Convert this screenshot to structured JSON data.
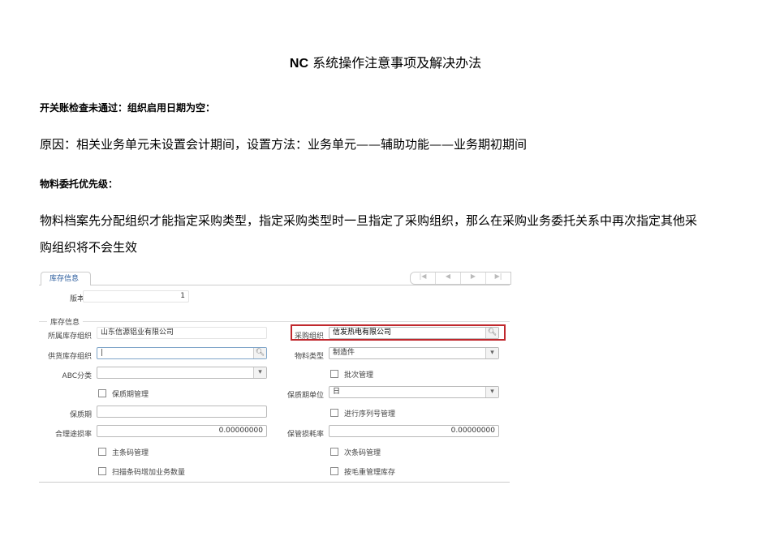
{
  "title": {
    "prefix": "NC",
    "rest": " 系统操作注意事项及解决办法"
  },
  "section1": {
    "heading": "开关账检查未通过：组织启用日期为空：",
    "body": "原因：相关业务单元未设置会计期间，设置方法：业务单元——辅助功能——业务期初期间"
  },
  "section2": {
    "heading": "物料委托优先级：",
    "body_line1": "物料档案先分配组织才能指定采购类型，指定采购类型时一旦指定了采购组织，那么在采购业务委托关系中再次指定其他采",
    "body_line2": "购组织将不会生效"
  },
  "screenshot": {
    "tab": "库存信息",
    "nav": [
      "first",
      "prev",
      "next",
      "last"
    ],
    "version_label": "版本号",
    "version_value": "1",
    "group_label": "库存信息",
    "owner_org_label": "所属库存组织",
    "owner_org_value": "山东信源铝业有限公司",
    "purchase_org_label": "采购组织",
    "purchase_org_value": "信发热电有限公司",
    "supply_org_label": "供货库存组织",
    "supply_org_value": "",
    "material_type_label": "物料类型",
    "material_type_value": "制造件",
    "abc_label": "ABC分类",
    "abc_value": "",
    "batch_label": "批次管理",
    "shelf_mgmt_label": "保质期管理",
    "shelf_unit_label": "保质期单位",
    "shelf_unit_value": "日",
    "shelf_label": "保质期",
    "shelf_value": "",
    "serial_label": "进行序列号管理",
    "loss_rate_label": "合理途损率",
    "loss_rate_value": "0.00000000",
    "storage_loss_label": "保管损耗率",
    "storage_loss_value": "0.00000000",
    "main_barcode_label": "主条码管理",
    "sub_barcode_label": "次条码管理",
    "scan_label": "扫描条码增加业务数量",
    "gross_label": "按毛重管理库存",
    "highlight_color": "#c0282d"
  }
}
